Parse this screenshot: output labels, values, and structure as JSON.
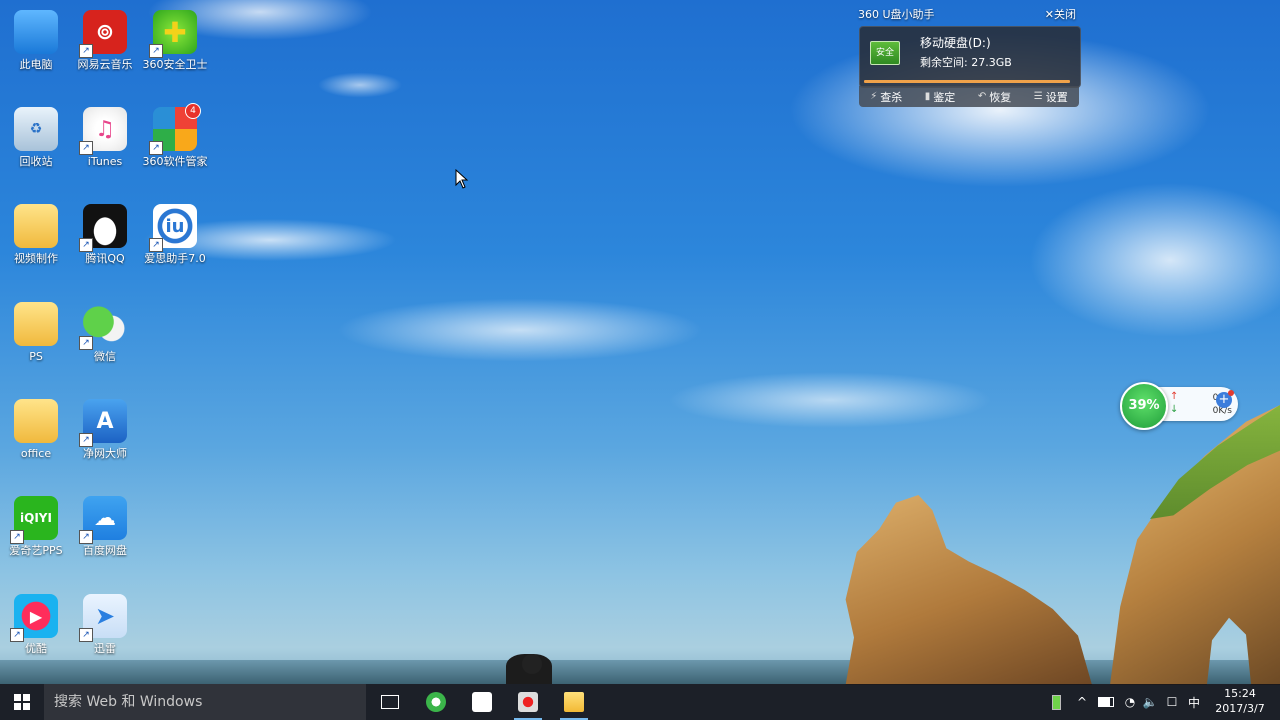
{
  "desktop_icons": [
    {
      "label": "此电脑",
      "icon": "computer-icon"
    },
    {
      "label": "网易云音乐",
      "icon": "netease-music-icon"
    },
    {
      "label": "360安全卫士",
      "icon": "360-safe-icon"
    },
    {
      "label": "回收站",
      "icon": "recycle-bin-icon"
    },
    {
      "label": "iTunes",
      "icon": "itunes-icon"
    },
    {
      "label": "360软件管家",
      "icon": "360-software-manager-icon",
      "badge": "4"
    },
    {
      "label": "视频制作",
      "icon": "folder-icon"
    },
    {
      "label": "腾讯QQ",
      "icon": "qq-icon"
    },
    {
      "label": "爱思助手7.0",
      "icon": "i4-assistant-icon"
    },
    {
      "label": "PS",
      "icon": "folder-icon"
    },
    {
      "label": "微信",
      "icon": "wechat-icon"
    },
    {
      "label": "office",
      "icon": "folder-icon"
    },
    {
      "label": "净网大师",
      "icon": "jingwang-icon"
    },
    {
      "label": "爱奇艺PPS",
      "icon": "iqiyi-icon"
    },
    {
      "label": "百度网盘",
      "icon": "baidu-netdisk-icon"
    },
    {
      "label": "优酷",
      "icon": "youku-icon"
    },
    {
      "label": "迅雷",
      "icon": "xunlei-icon"
    }
  ],
  "usb_helper": {
    "title": "360 U盘小助手",
    "close_label": "✕关闭",
    "drive_badge": "安全",
    "drive_name": "移动硬盘(D:)",
    "free_space": "剩余空间: 27.3GB",
    "actions": [
      {
        "label": "查杀",
        "icon": "scan-icon"
      },
      {
        "label": "鉴定",
        "icon": "identify-icon"
      },
      {
        "label": "恢复",
        "icon": "restore-icon"
      },
      {
        "label": "设置",
        "icon": "settings-icon"
      }
    ]
  },
  "net_widget": {
    "percent": "39%",
    "upload": "0K/s",
    "download": "0K/s"
  },
  "taskbar": {
    "search_placeholder": "搜索 Web 和 Windows",
    "apps": [
      {
        "name": "task-view",
        "icon": "task-view-icon"
      },
      {
        "name": "360-browser",
        "icon": "360-browser-icon"
      },
      {
        "name": "store",
        "icon": "store-icon"
      },
      {
        "name": "screen-recorder",
        "icon": "record-icon"
      },
      {
        "name": "file-explorer",
        "icon": "folder-icon"
      }
    ],
    "ime": "中",
    "time": "15:24",
    "date": "2017/3/7"
  },
  "colors": {
    "taskbar": "#12141a",
    "accent_active": "#76b9ed",
    "usb_progress": "#e88d2e",
    "net_green": "#1f9d3a"
  }
}
